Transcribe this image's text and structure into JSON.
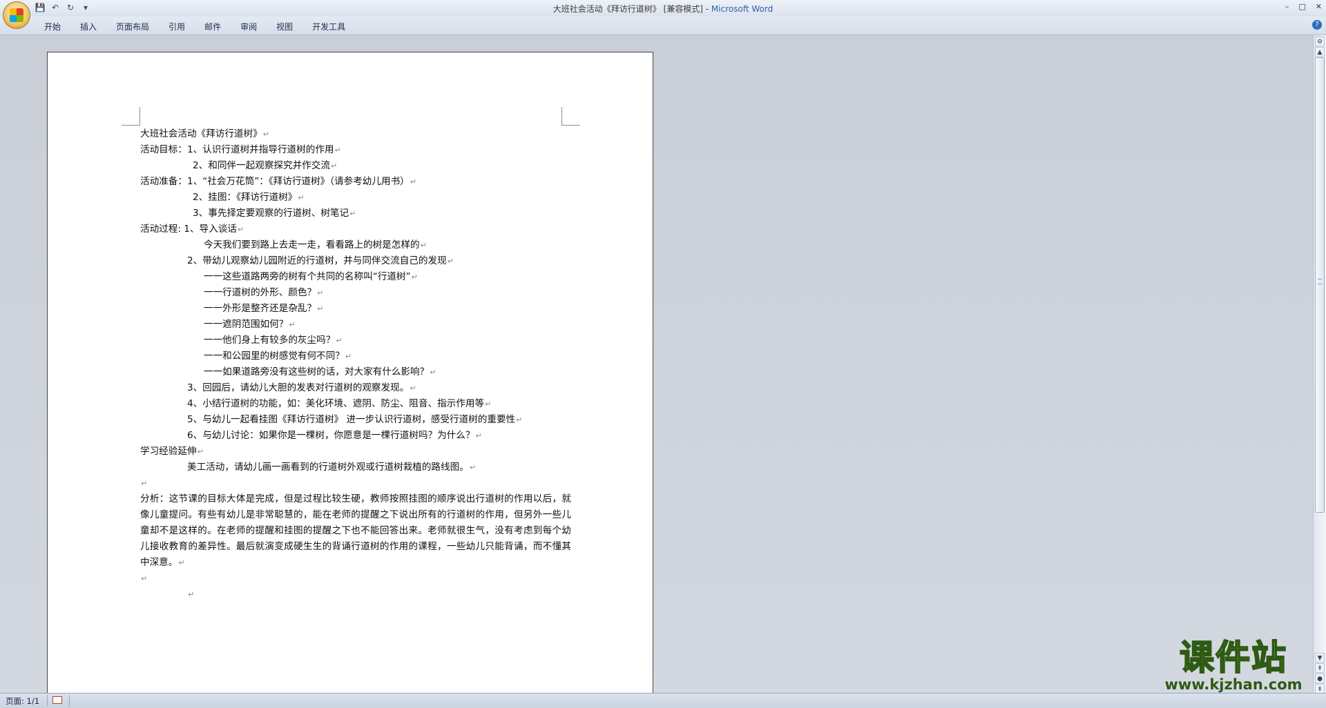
{
  "window": {
    "title_prefix": "大班社会活动《拜访行道树》 [兼容模式] - ",
    "title_brand": "Microsoft Word",
    "controls": [
      "–",
      "□",
      "✕"
    ]
  },
  "quick_access": {
    "save": "💾",
    "undo": "↶",
    "redo": "↻",
    "customize": "▾"
  },
  "ribbon": {
    "tabs": [
      "开始",
      "插入",
      "页面布局",
      "引用",
      "邮件",
      "审阅",
      "视图",
      "开发工具"
    ],
    "help": "?"
  },
  "document": {
    "lines": [
      {
        "text": "大班社会活动《拜访行道树》",
        "indent": ""
      },
      {
        "text": "活动目标：1、认识行道树并指导行道树的作用",
        "indent": ""
      },
      {
        "text": "2、和同伴一起观察探究并作交流",
        "indent": "i2"
      },
      {
        "text": "活动准备：1、“社会万花筒”：《拜访行道树》（请参考幼儿用书）",
        "indent": ""
      },
      {
        "text": "2、挂图：《拜访行道树》",
        "indent": "i2"
      },
      {
        "text": "3、事先择定要观察的行道树、树笔记",
        "indent": "i2"
      },
      {
        "text": "活动过程: 1、导入谈话",
        "indent": ""
      },
      {
        "text": "今天我们要到路上去走一走，看看路上的树是怎样的",
        "indent": "i4"
      },
      {
        "text": "2、带幼儿观察幼儿园附近的行道树，并与同伴交流自己的发现",
        "indent": "i3"
      },
      {
        "text": "一一这些道路两旁的树有个共同的名称叫“行道树”",
        "indent": "i4"
      },
      {
        "text": "一一行道树的外形、颜色？",
        "indent": "i4"
      },
      {
        "text": "一一外形是整齐还是杂乱？",
        "indent": "i4"
      },
      {
        "text": "一一遮阴范围如何？",
        "indent": "i4"
      },
      {
        "text": "一一他们身上有较多的灰尘吗？",
        "indent": "i4"
      },
      {
        "text": "一一和公园里的树感觉有何不同？",
        "indent": "i4"
      },
      {
        "text": "一一如果道路旁没有这些树的话，对大家有什么影响？",
        "indent": "i4"
      },
      {
        "text": "3、回园后，请幼儿大胆的发表对行道树的观察发现。",
        "indent": "i3"
      },
      {
        "text": "4、小结行道树的功能，如：美化环境、遮阴、防尘、阻音、指示作用等",
        "indent": "i3"
      },
      {
        "text": "5、与幼儿一起看挂图《拜访行道树》 进一步认识行道树，感受行道树的重要性",
        "indent": "i3"
      },
      {
        "text": "6、与幼儿讨论：如果你是一棵树，你愿意是一棵行道树吗？为什么？",
        "indent": "i3"
      },
      {
        "text": "学习经验延伸",
        "indent": ""
      },
      {
        "text": "美工活动，请幼儿画一画看到的行道树外观或行道树栽植的路线图。",
        "indent": "i3"
      },
      {
        "text": "",
        "indent": ""
      }
    ],
    "analysis": "分析：这节课的目标大体是完成，但是过程比较生硬，教师按照挂图的顺序说出行道树的作用以后，就像儿童提问。有些有幼儿是非常聪慧的，能在老师的提醒之下说出所有的行道树的作用，但另外一些儿童却不是这样的。在老师的提醒和挂图的提醒之下也不能回答出来。老师就很生气，没有考虑到每个幼儿接收教育的差异性。最后就演变成硬生生的背诵行道树的作用的课程，一些幼儿只能背诵，而不懂其中深意。",
    "paragraph_mark": "↵"
  },
  "statusbar": {
    "page_info": "页面: 1/1"
  },
  "watermark": {
    "title": "课件站",
    "url": "www.kjzhan.com"
  },
  "colors": {
    "brand": "#2f5ea8",
    "workspace": "#cfd5de",
    "watermark_fill": "#f5d400",
    "watermark_stroke": "#2d5a14"
  }
}
